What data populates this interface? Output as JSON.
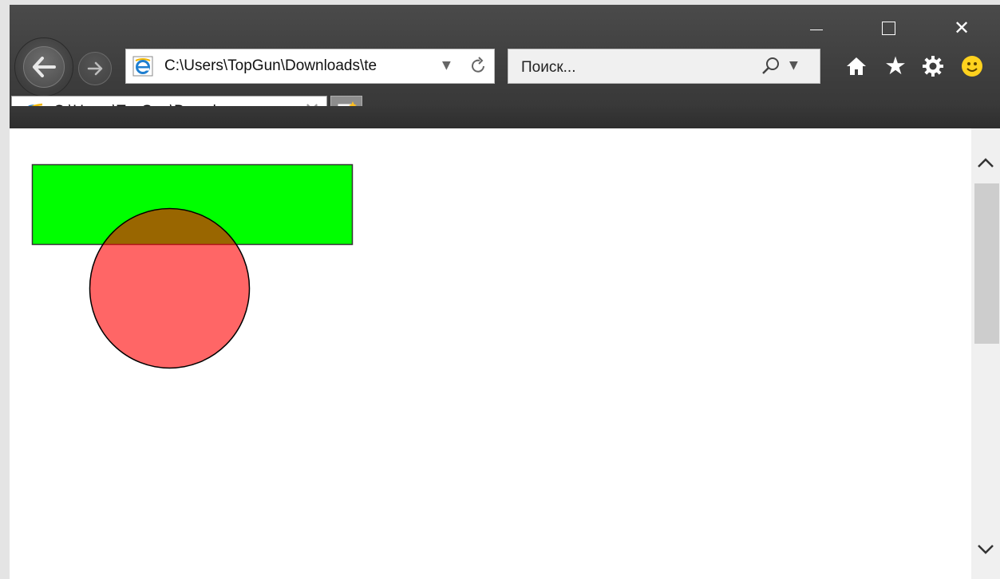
{
  "window": {
    "minimize_label": "—",
    "maximize_label": "☐",
    "close_label": "✕"
  },
  "navigation": {
    "back_icon": "arrow-left-icon",
    "forward_icon": "arrow-right-icon"
  },
  "address_bar": {
    "url": "C:\\Users\\TopGun\\Downloads\\te",
    "dropdown_icon": "chevron-down-icon",
    "refresh_icon": "refresh-icon"
  },
  "search_bar": {
    "placeholder": "Поиск...",
    "icon": "search-icon",
    "dropdown_icon": "chevron-down-icon"
  },
  "toolbar": {
    "icons": [
      "home-icon",
      "favorites-star-icon",
      "settings-gear-icon",
      "smiley-feedback-icon"
    ]
  },
  "tabs": [
    {
      "label": "C:\\Users\\TopGun\\Downloa...",
      "close_label": "✕",
      "active": true
    }
  ],
  "new_tab": {
    "icon": "new-tab-icon"
  },
  "page_content": {
    "shapes": [
      {
        "type": "rectangle",
        "fill": "#00ff00",
        "stroke": "#333333"
      },
      {
        "type": "circle",
        "fill": "#ff0000",
        "fill_opacity": 0.6,
        "stroke": "#000000"
      }
    ]
  },
  "scrollbar": {
    "up_icon": "chevron-up-icon",
    "down_icon": "chevron-down-icon",
    "thumb_color": "#cdcdcd"
  }
}
